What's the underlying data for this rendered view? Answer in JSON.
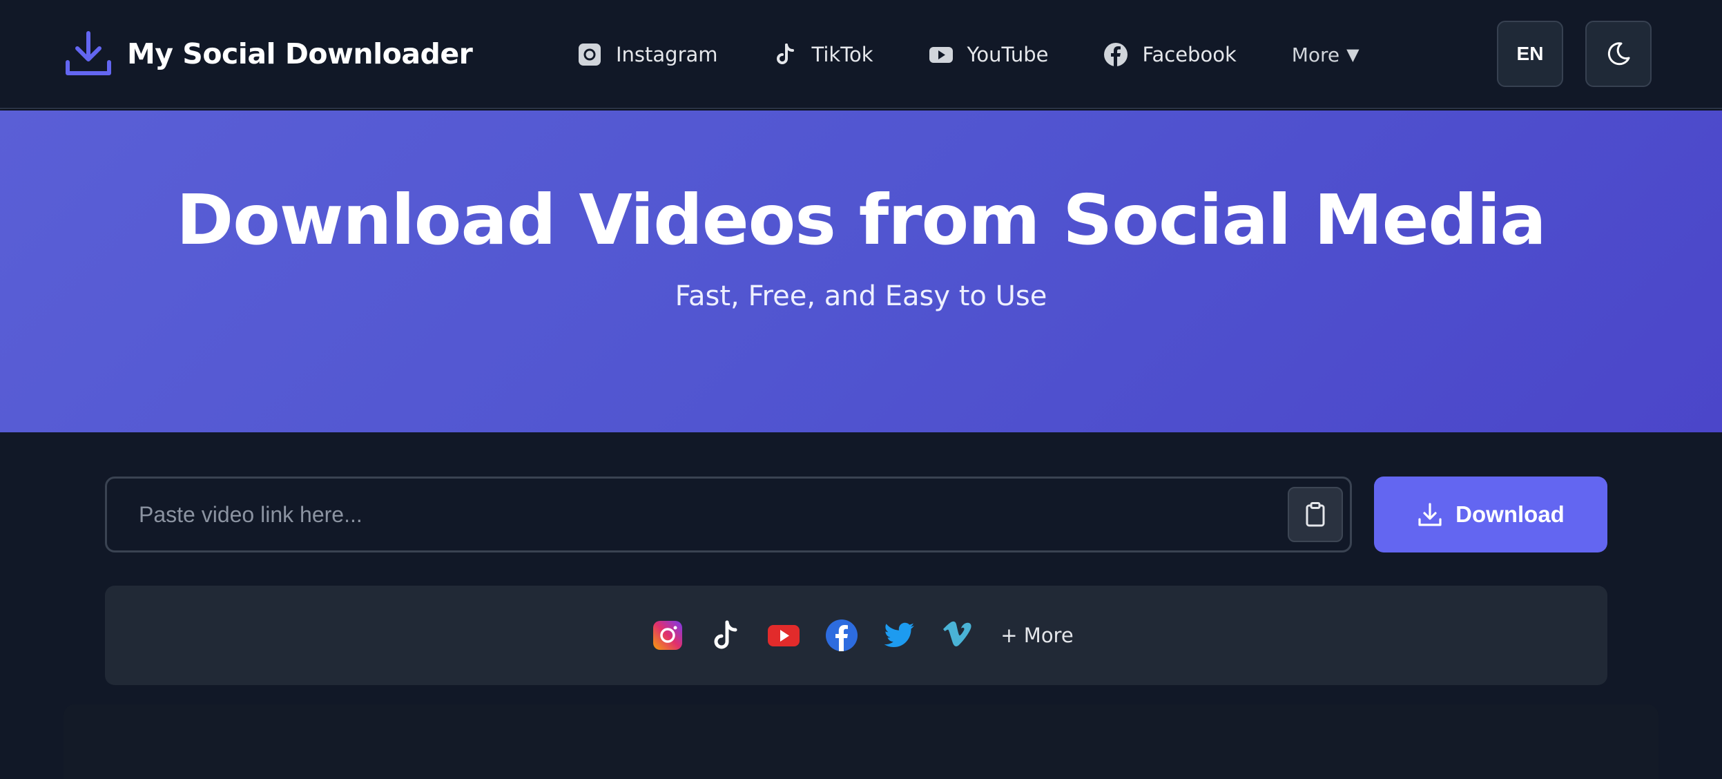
{
  "header": {
    "brand_title": "My Social Downloader",
    "brand_icon": "download-icon",
    "accent_color": "#6366f1",
    "nav": [
      {
        "label": "Instagram",
        "icon": "instagram-icon"
      },
      {
        "label": "TikTok",
        "icon": "tiktok-icon"
      },
      {
        "label": "YouTube",
        "icon": "youtube-icon"
      },
      {
        "label": "Facebook",
        "icon": "facebook-icon"
      },
      {
        "label": "More",
        "icon": "caret-down-icon"
      }
    ],
    "lang_label": "EN",
    "theme_icon": "moon-icon"
  },
  "hero": {
    "title": "Download Videos from Social Media",
    "subtitle": "Fast, Free, and Easy to Use"
  },
  "search": {
    "placeholder": "Paste video link here...",
    "value": "",
    "paste_icon": "clipboard-icon",
    "download_label": "Download"
  },
  "platforms": {
    "icons": [
      "instagram-icon",
      "tiktok-icon",
      "youtube-icon",
      "facebook-icon",
      "twitter-icon",
      "vimeo-icon"
    ],
    "more_label": "+ More"
  }
}
